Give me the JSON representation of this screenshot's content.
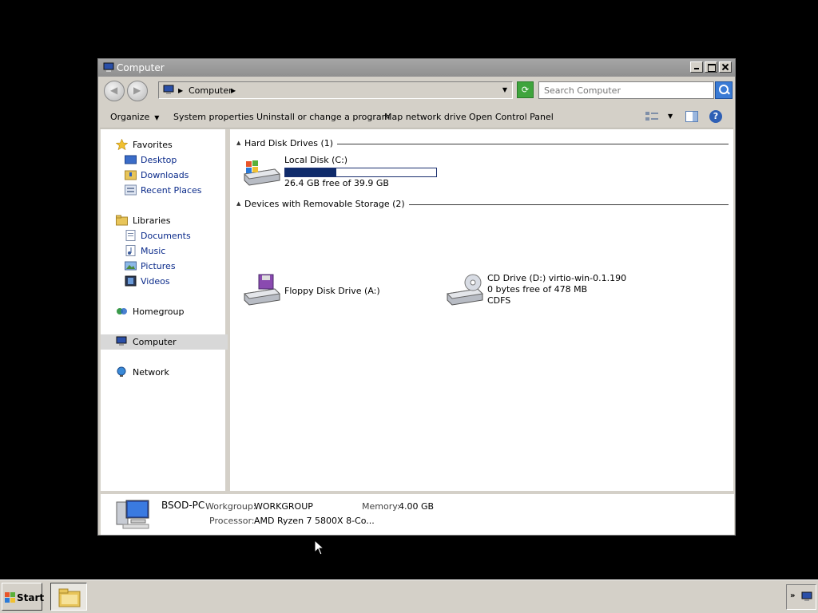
{
  "window": {
    "title": "Computer",
    "minimize_icon": "minimize-icon",
    "maximize_icon": "maximize-icon",
    "close_icon": "close-icon"
  },
  "address": {
    "crumb": "Computer",
    "search_placeholder": "Search Computer"
  },
  "toolbar": {
    "organize": "Organize",
    "system_properties": "System properties",
    "uninstall": "Uninstall or change a program",
    "map_drive": "Map network drive",
    "control_panel": "Open Control Panel"
  },
  "nav": {
    "favorites": "Favorites",
    "desktop": "Desktop",
    "downloads": "Downloads",
    "recent_places": "Recent Places",
    "libraries": "Libraries",
    "documents": "Documents",
    "music": "Music",
    "pictures": "Pictures",
    "videos": "Videos",
    "homegroup": "Homegroup",
    "computer": "Computer",
    "network": "Network"
  },
  "groups": {
    "hdd": "Hard Disk Drives (1)",
    "removable": "Devices with Removable Storage (2)"
  },
  "drives": {
    "local": {
      "name": "Local Disk (C:)",
      "free": "26.4 GB free of 39.9 GB",
      "used_fraction": 0.34
    },
    "floppy": {
      "name": "Floppy Disk Drive (A:)"
    },
    "cd": {
      "name": "CD Drive (D:) virtio-win-0.1.190",
      "free": "0 bytes free of 478 MB",
      "fs": "CDFS"
    }
  },
  "details": {
    "pc_name": "BSOD-PC",
    "workgroup_label": "Workgroup:",
    "workgroup": "WORKGROUP",
    "memory_label": "Memory:",
    "memory": "4.00 GB",
    "processor_label": "Processor:",
    "processor": "AMD Ryzen 7 5800X 8-Co..."
  },
  "taskbar": {
    "start": "Start",
    "tray_chevron": "»"
  },
  "colors": {
    "drive_bar": "#0f2b6b",
    "link_blue": "#0a2a8a",
    "selection": "#d8d8d8"
  }
}
